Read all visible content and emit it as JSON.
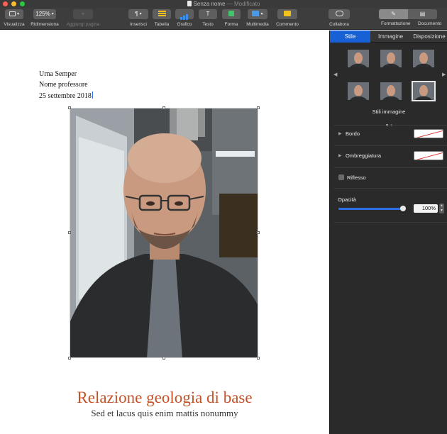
{
  "window": {
    "title": "Senza nome",
    "title_suffix": "— Modificato"
  },
  "toolbar": {
    "view_label": "Visualizza",
    "zoom_value": "125%",
    "zoom_label": "Ridimensiona",
    "add_page_label": "Aggiungi pagina",
    "insert_label": "Inserisci",
    "insert_glyph": "¶",
    "table_label": "Tabella",
    "chart_label": "Grafico",
    "text_label": "Testo",
    "text_glyph": "T",
    "shape_label": "Forma",
    "media_label": "Multimedia",
    "comment_label": "Commento",
    "collab_label": "Collabora",
    "format_label": "Formattazione",
    "document_label": "Documento"
  },
  "document": {
    "author": "Urna Semper",
    "professor": "Nome professore",
    "date": "25 settembre 2018",
    "title": "Relazione geologia di base",
    "subtitle": "Sed et lacus quis enim mattis nonummy"
  },
  "inspector": {
    "tabs": [
      "Stile",
      "Immagine",
      "Disposizione"
    ],
    "image_styles_label": "Stili immagine",
    "border_label": "Bordo",
    "shadow_label": "Ombreggiatura",
    "reflection_label": "Riflesso",
    "opacity_label": "Opacità",
    "opacity_value": "100%",
    "opacity_fraction": 1.0
  },
  "colors": {
    "accent": "#1760d6",
    "title_red": "#c4532a",
    "toolbar_bg": "#3d3d3d",
    "inspector_bg": "#2a2a2a"
  }
}
